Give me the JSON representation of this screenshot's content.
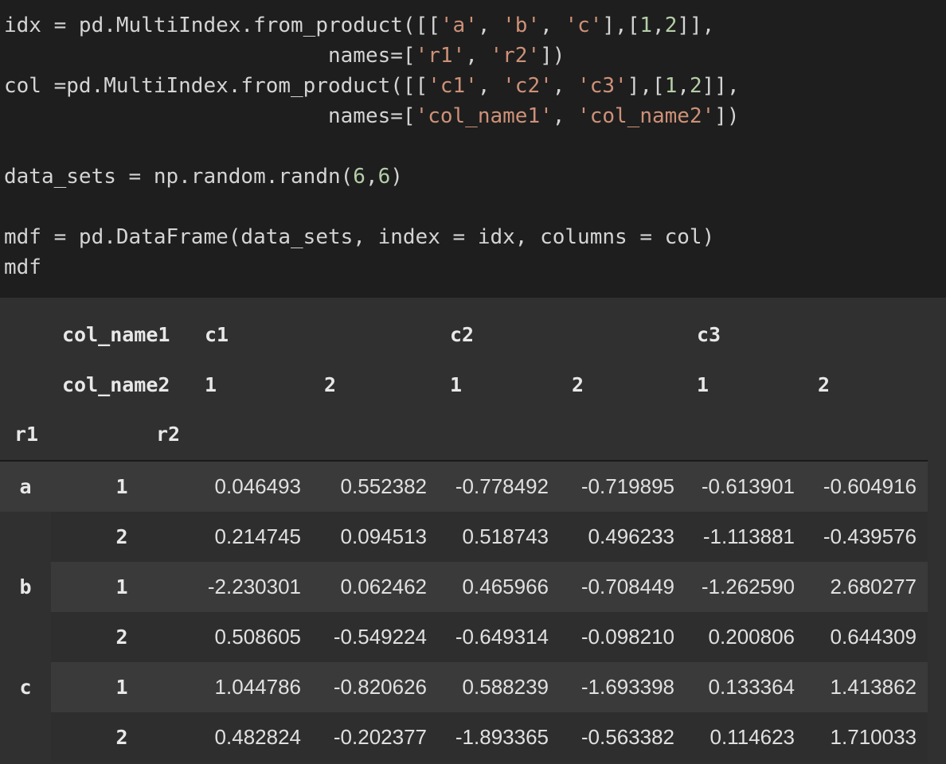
{
  "code": {
    "line1": {
      "p0": "idx = pd.MultiIndex.from_product([[",
      "s1": "'a'",
      "p1": ", ",
      "s2": "'b'",
      "p2": ", ",
      "s3": "'c'",
      "p3": "],[",
      "n1": "1",
      "p4": ",",
      "n2": "2",
      "p5": "]],"
    },
    "line2": {
      "p0": "                          names=[",
      "s1": "'r1'",
      "p1": ", ",
      "s2": "'r2'",
      "p2": "])"
    },
    "line3": {
      "p0": "col =pd.MultiIndex.from_product([[",
      "s1": "'c1'",
      "p1": ", ",
      "s2": "'c2'",
      "p2": ", ",
      "s3": "'c3'",
      "p3": "],[",
      "n1": "1",
      "p4": ",",
      "n2": "2",
      "p5": "]],"
    },
    "line4": {
      "p0": "                          names=[",
      "s1": "'col_name1'",
      "p1": ", ",
      "s2": "'col_name2'",
      "p2": "])"
    },
    "line5": {
      "p0": "data_sets = np.random.randn(",
      "n1": "6",
      "p1": ",",
      "n2": "6",
      "p2": ")"
    },
    "line6": {
      "p0": "mdf = pd.DataFrame(data_sets, index = idx, columns = col)"
    },
    "line7": {
      "p0": "mdf"
    }
  },
  "table": {
    "col_level_names": [
      "col_name1",
      "col_name2"
    ],
    "col_level1": [
      "c1",
      "c2",
      "c3"
    ],
    "col_level2": [
      "1",
      "2",
      "1",
      "2",
      "1",
      "2"
    ],
    "row_level_names": [
      "r1",
      "r2"
    ],
    "rows": [
      {
        "r1": "a",
        "r2": "1",
        "values": [
          "0.046493",
          "0.552382",
          "-0.778492",
          "-0.719895",
          "-0.613901",
          "-0.604916"
        ]
      },
      {
        "r1": "",
        "r2": "2",
        "values": [
          "0.214745",
          "0.094513",
          "0.518743",
          "0.496233",
          "-1.113881",
          "-0.439576"
        ]
      },
      {
        "r1": "b",
        "r2": "1",
        "values": [
          "-2.230301",
          "0.062462",
          "0.465966",
          "-0.708449",
          "-1.262590",
          "2.680277"
        ]
      },
      {
        "r1": "",
        "r2": "2",
        "values": [
          "0.508605",
          "-0.549224",
          "-0.649314",
          "-0.098210",
          "0.200806",
          "0.644309"
        ]
      },
      {
        "r1": "c",
        "r2": "1",
        "values": [
          "1.044786",
          "-0.820626",
          "0.588239",
          "-1.693398",
          "0.133364",
          "1.413862"
        ]
      },
      {
        "r1": "",
        "r2": "2",
        "values": [
          "0.482824",
          "-0.202377",
          "-1.893365",
          "-0.563382",
          "0.114623",
          "1.710033"
        ]
      }
    ]
  }
}
